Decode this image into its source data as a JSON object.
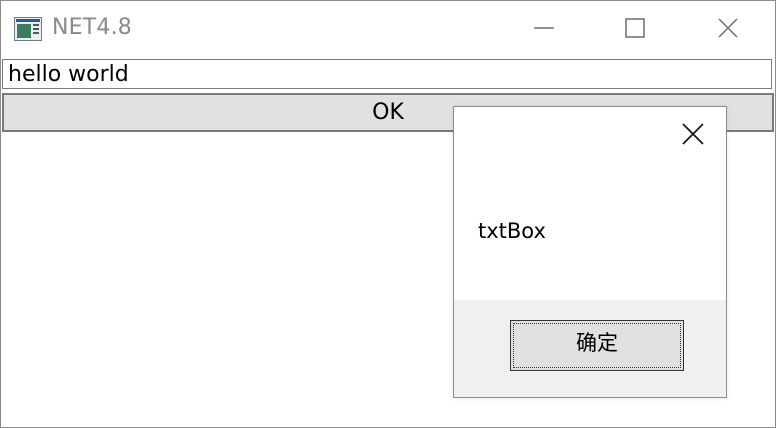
{
  "window": {
    "title": "NET4.8",
    "icon": "app-window-icon",
    "controls": [
      "minimize-icon",
      "maximize-icon",
      "close-icon"
    ]
  },
  "form": {
    "textbox_value": "hello world",
    "ok_button_label": "OK"
  },
  "message_box": {
    "text": "txtBox",
    "confirm_label": "确定",
    "close_icon": "close-icon"
  },
  "colors": {
    "title_text": "#8a8a8a",
    "button_face": "#e1e1e1",
    "dialog_footer": "#f0f0f0"
  }
}
